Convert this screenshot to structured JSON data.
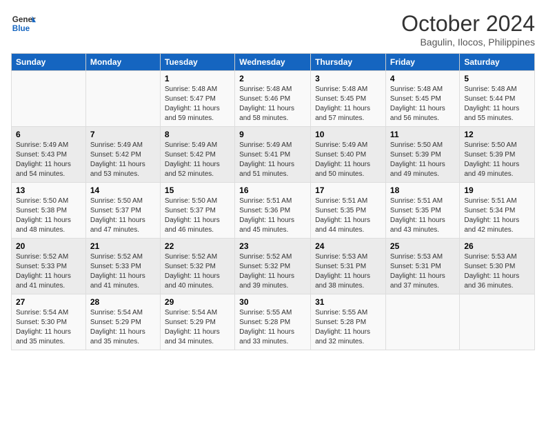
{
  "header": {
    "logo_general": "General",
    "logo_blue": "Blue",
    "month_year": "October 2024",
    "location": "Bagulin, Ilocos, Philippines"
  },
  "days_of_week": [
    "Sunday",
    "Monday",
    "Tuesday",
    "Wednesday",
    "Thursday",
    "Friday",
    "Saturday"
  ],
  "weeks": [
    [
      {
        "day": "",
        "sunrise": "",
        "sunset": "",
        "daylight": ""
      },
      {
        "day": "",
        "sunrise": "",
        "sunset": "",
        "daylight": ""
      },
      {
        "day": "1",
        "sunrise": "Sunrise: 5:48 AM",
        "sunset": "Sunset: 5:47 PM",
        "daylight": "Daylight: 11 hours and 59 minutes."
      },
      {
        "day": "2",
        "sunrise": "Sunrise: 5:48 AM",
        "sunset": "Sunset: 5:46 PM",
        "daylight": "Daylight: 11 hours and 58 minutes."
      },
      {
        "day": "3",
        "sunrise": "Sunrise: 5:48 AM",
        "sunset": "Sunset: 5:45 PM",
        "daylight": "Daylight: 11 hours and 57 minutes."
      },
      {
        "day": "4",
        "sunrise": "Sunrise: 5:48 AM",
        "sunset": "Sunset: 5:45 PM",
        "daylight": "Daylight: 11 hours and 56 minutes."
      },
      {
        "day": "5",
        "sunrise": "Sunrise: 5:48 AM",
        "sunset": "Sunset: 5:44 PM",
        "daylight": "Daylight: 11 hours and 55 minutes."
      }
    ],
    [
      {
        "day": "6",
        "sunrise": "Sunrise: 5:49 AM",
        "sunset": "Sunset: 5:43 PM",
        "daylight": "Daylight: 11 hours and 54 minutes."
      },
      {
        "day": "7",
        "sunrise": "Sunrise: 5:49 AM",
        "sunset": "Sunset: 5:42 PM",
        "daylight": "Daylight: 11 hours and 53 minutes."
      },
      {
        "day": "8",
        "sunrise": "Sunrise: 5:49 AM",
        "sunset": "Sunset: 5:42 PM",
        "daylight": "Daylight: 11 hours and 52 minutes."
      },
      {
        "day": "9",
        "sunrise": "Sunrise: 5:49 AM",
        "sunset": "Sunset: 5:41 PM",
        "daylight": "Daylight: 11 hours and 51 minutes."
      },
      {
        "day": "10",
        "sunrise": "Sunrise: 5:49 AM",
        "sunset": "Sunset: 5:40 PM",
        "daylight": "Daylight: 11 hours and 50 minutes."
      },
      {
        "day": "11",
        "sunrise": "Sunrise: 5:50 AM",
        "sunset": "Sunset: 5:39 PM",
        "daylight": "Daylight: 11 hours and 49 minutes."
      },
      {
        "day": "12",
        "sunrise": "Sunrise: 5:50 AM",
        "sunset": "Sunset: 5:39 PM",
        "daylight": "Daylight: 11 hours and 49 minutes."
      }
    ],
    [
      {
        "day": "13",
        "sunrise": "Sunrise: 5:50 AM",
        "sunset": "Sunset: 5:38 PM",
        "daylight": "Daylight: 11 hours and 48 minutes."
      },
      {
        "day": "14",
        "sunrise": "Sunrise: 5:50 AM",
        "sunset": "Sunset: 5:37 PM",
        "daylight": "Daylight: 11 hours and 47 minutes."
      },
      {
        "day": "15",
        "sunrise": "Sunrise: 5:50 AM",
        "sunset": "Sunset: 5:37 PM",
        "daylight": "Daylight: 11 hours and 46 minutes."
      },
      {
        "day": "16",
        "sunrise": "Sunrise: 5:51 AM",
        "sunset": "Sunset: 5:36 PM",
        "daylight": "Daylight: 11 hours and 45 minutes."
      },
      {
        "day": "17",
        "sunrise": "Sunrise: 5:51 AM",
        "sunset": "Sunset: 5:35 PM",
        "daylight": "Daylight: 11 hours and 44 minutes."
      },
      {
        "day": "18",
        "sunrise": "Sunrise: 5:51 AM",
        "sunset": "Sunset: 5:35 PM",
        "daylight": "Daylight: 11 hours and 43 minutes."
      },
      {
        "day": "19",
        "sunrise": "Sunrise: 5:51 AM",
        "sunset": "Sunset: 5:34 PM",
        "daylight": "Daylight: 11 hours and 42 minutes."
      }
    ],
    [
      {
        "day": "20",
        "sunrise": "Sunrise: 5:52 AM",
        "sunset": "Sunset: 5:33 PM",
        "daylight": "Daylight: 11 hours and 41 minutes."
      },
      {
        "day": "21",
        "sunrise": "Sunrise: 5:52 AM",
        "sunset": "Sunset: 5:33 PM",
        "daylight": "Daylight: 11 hours and 41 minutes."
      },
      {
        "day": "22",
        "sunrise": "Sunrise: 5:52 AM",
        "sunset": "Sunset: 5:32 PM",
        "daylight": "Daylight: 11 hours and 40 minutes."
      },
      {
        "day": "23",
        "sunrise": "Sunrise: 5:52 AM",
        "sunset": "Sunset: 5:32 PM",
        "daylight": "Daylight: 11 hours and 39 minutes."
      },
      {
        "day": "24",
        "sunrise": "Sunrise: 5:53 AM",
        "sunset": "Sunset: 5:31 PM",
        "daylight": "Daylight: 11 hours and 38 minutes."
      },
      {
        "day": "25",
        "sunrise": "Sunrise: 5:53 AM",
        "sunset": "Sunset: 5:31 PM",
        "daylight": "Daylight: 11 hours and 37 minutes."
      },
      {
        "day": "26",
        "sunrise": "Sunrise: 5:53 AM",
        "sunset": "Sunset: 5:30 PM",
        "daylight": "Daylight: 11 hours and 36 minutes."
      }
    ],
    [
      {
        "day": "27",
        "sunrise": "Sunrise: 5:54 AM",
        "sunset": "Sunset: 5:30 PM",
        "daylight": "Daylight: 11 hours and 35 minutes."
      },
      {
        "day": "28",
        "sunrise": "Sunrise: 5:54 AM",
        "sunset": "Sunset: 5:29 PM",
        "daylight": "Daylight: 11 hours and 35 minutes."
      },
      {
        "day": "29",
        "sunrise": "Sunrise: 5:54 AM",
        "sunset": "Sunset: 5:29 PM",
        "daylight": "Daylight: 11 hours and 34 minutes."
      },
      {
        "day": "30",
        "sunrise": "Sunrise: 5:55 AM",
        "sunset": "Sunset: 5:28 PM",
        "daylight": "Daylight: 11 hours and 33 minutes."
      },
      {
        "day": "31",
        "sunrise": "Sunrise: 5:55 AM",
        "sunset": "Sunset: 5:28 PM",
        "daylight": "Daylight: 11 hours and 32 minutes."
      },
      {
        "day": "",
        "sunrise": "",
        "sunset": "",
        "daylight": ""
      },
      {
        "day": "",
        "sunrise": "",
        "sunset": "",
        "daylight": ""
      }
    ]
  ]
}
